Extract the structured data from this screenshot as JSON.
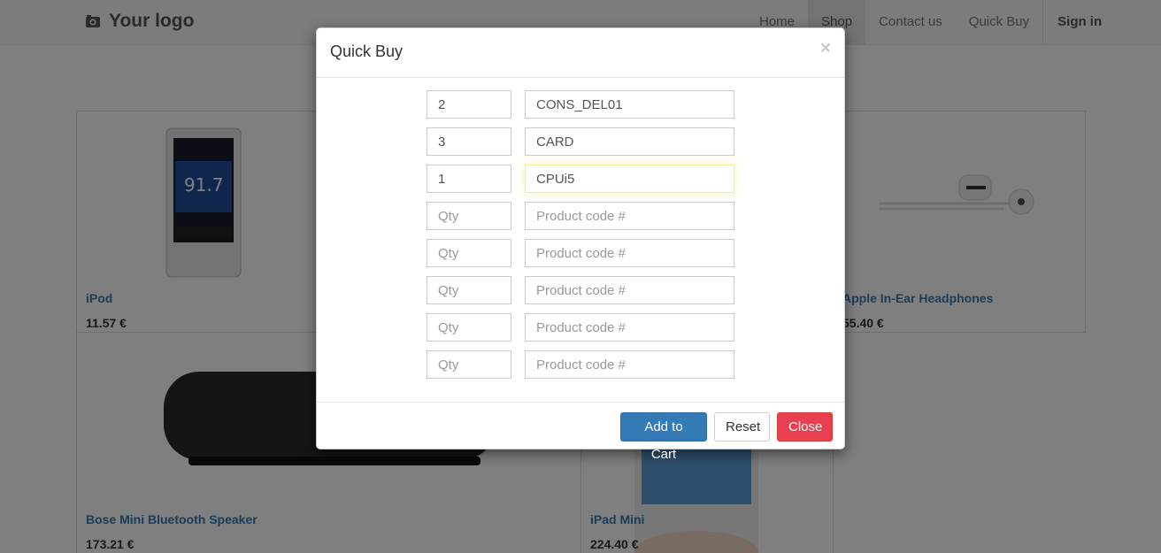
{
  "header": {
    "logo_text": "Your logo",
    "nav": [
      "Home",
      "Shop",
      "Contact us",
      "Quick Buy"
    ],
    "active_nav": "Shop",
    "sign_in": "Sign in"
  },
  "products": [
    {
      "name": "iPod",
      "price": "11.57 €"
    },
    {
      "name": "Apple In-Ear Headphones",
      "price": "55.40 €"
    },
    {
      "name": "Bose Mini Bluetooth Speaker",
      "price": "173.21 €"
    },
    {
      "name": "iPad Mini",
      "price": "224.40 €"
    }
  ],
  "ipod_screen": {
    "freq": "91.7"
  },
  "modal": {
    "title": "Quick Buy",
    "close_glyph": "×",
    "rows": [
      {
        "qty": "2",
        "code": "CONS_DEL01"
      },
      {
        "qty": "3",
        "code": "CARD"
      },
      {
        "qty": "1",
        "code": "CPUi5"
      },
      {
        "qty": "",
        "code": ""
      },
      {
        "qty": "",
        "code": ""
      },
      {
        "qty": "",
        "code": ""
      },
      {
        "qty": "",
        "code": ""
      },
      {
        "qty": "",
        "code": ""
      }
    ],
    "qty_placeholder": "Qty",
    "code_placeholder": "Product code #",
    "add_to_cart": "Add to Cart",
    "reset": "Reset",
    "close": "Close"
  },
  "colors": {
    "primary": "#337ab7",
    "danger": "#e84050",
    "link": "#337ab7"
  }
}
